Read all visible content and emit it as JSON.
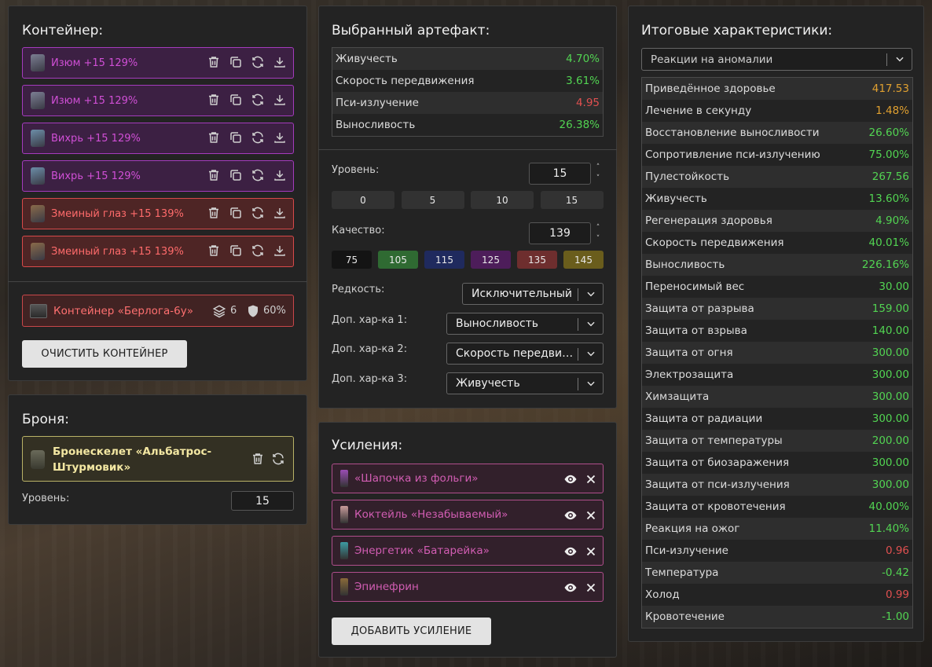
{
  "container": {
    "title": "Контейнер:",
    "items": [
      {
        "label": "Изюм +15 129%"
      },
      {
        "label": "Изюм +15 129%"
      },
      {
        "label": "Вихрь +15 129%"
      },
      {
        "label": "Вихрь +15 129%"
      },
      {
        "label": "Змеиный глаз +15 139%"
      },
      {
        "label": "Змеиный глаз +15 139%"
      }
    ],
    "box": {
      "name": "Контейнер «Берлога-6у»",
      "slots": "6",
      "protection": "60%"
    },
    "clear_button": "ОЧИСТИТЬ КОНТЕЙНЕР"
  },
  "armor": {
    "title": "Броня:",
    "name": "Бронескелет «Альбатрос-Штурмовик»",
    "level_label": "Уровень:",
    "level_value": "15"
  },
  "artifact": {
    "title": "Выбранный артефакт:",
    "stats": [
      {
        "name": "Живучесть",
        "value": "4.70%"
      },
      {
        "name": "Скорость передвижения",
        "value": "3.61%"
      },
      {
        "name": "Пси-излучение",
        "value": "4.95"
      },
      {
        "name": "Выносливость",
        "value": "26.38%"
      }
    ],
    "level_label": "Уровень:",
    "level_value": "15",
    "level_presets": [
      "0",
      "5",
      "10",
      "15"
    ],
    "quality_label": "Качество:",
    "quality_value": "139",
    "quality_presets": [
      "75",
      "105",
      "115",
      "125",
      "135",
      "145"
    ],
    "rarity_label": "Редкость:",
    "rarity_value": "Исключительный",
    "extra1_label": "Доп. хар-ка 1:",
    "extra1_value": "Выносливость",
    "extra2_label": "Доп. хар-ка 2:",
    "extra2_value": "Скорость передвижения",
    "extra3_label": "Доп. хар-ка 3:",
    "extra3_value": "Живучесть"
  },
  "boosts": {
    "title": "Усиления:",
    "items": [
      {
        "label": "«Шапочка из фольги»"
      },
      {
        "label": "Коктейль «Незабываемый»"
      },
      {
        "label": "Энергетик «Батарейка»"
      },
      {
        "label": "Эпинефрин"
      }
    ],
    "add_button": "ДОБАВИТЬ УСИЛЕНИЕ"
  },
  "totals": {
    "title": "Итоговые характеристики:",
    "filter_value": "Реакции на аномалии",
    "stats": [
      {
        "name": "Приведённое здоровье",
        "value": "417.53"
      },
      {
        "name": "Лечение в секунду",
        "value": "1.48%"
      },
      {
        "name": "Восстановление выносливости",
        "value": "26.60%"
      },
      {
        "name": "Сопротивление пси-излучению",
        "value": "75.00%"
      },
      {
        "name": "Пулестойкость",
        "value": "267.56"
      },
      {
        "name": "Живучесть",
        "value": "13.60%"
      },
      {
        "name": "Регенерация здоровья",
        "value": "4.90%"
      },
      {
        "name": "Скорость передвижения",
        "value": "40.01%"
      },
      {
        "name": "Выносливость",
        "value": "226.16%"
      },
      {
        "name": "Переносимый вес",
        "value": "30.00"
      },
      {
        "name": "Защита от разрыва",
        "value": "159.00"
      },
      {
        "name": "Защита от взрыва",
        "value": "140.00"
      },
      {
        "name": "Защита от огня",
        "value": "300.00"
      },
      {
        "name": "Электрозащита",
        "value": "300.00"
      },
      {
        "name": "Химзащита",
        "value": "300.00"
      },
      {
        "name": "Защита от радиации",
        "value": "300.00"
      },
      {
        "name": "Защита от температуры",
        "value": "200.00"
      },
      {
        "name": "Защита от биозаражения",
        "value": "300.00"
      },
      {
        "name": "Защита от пси-излучения",
        "value": "300.00"
      },
      {
        "name": "Защита от кровотечения",
        "value": "40.00%"
      },
      {
        "name": "Реакция на ожог",
        "value": "11.40%"
      },
      {
        "name": "Пси-излучение",
        "value": "0.96"
      },
      {
        "name": "Температура",
        "value": "-0.42"
      },
      {
        "name": "Холод",
        "value": "0.99"
      },
      {
        "name": "Кровотечение",
        "value": "-1.00"
      }
    ]
  },
  "colors": {
    "positive": "#52d452",
    "negative": "#e05050",
    "highlight": "#e0a030",
    "purple_item": "#a43bbd",
    "red_item": "#d84a4a"
  }
}
